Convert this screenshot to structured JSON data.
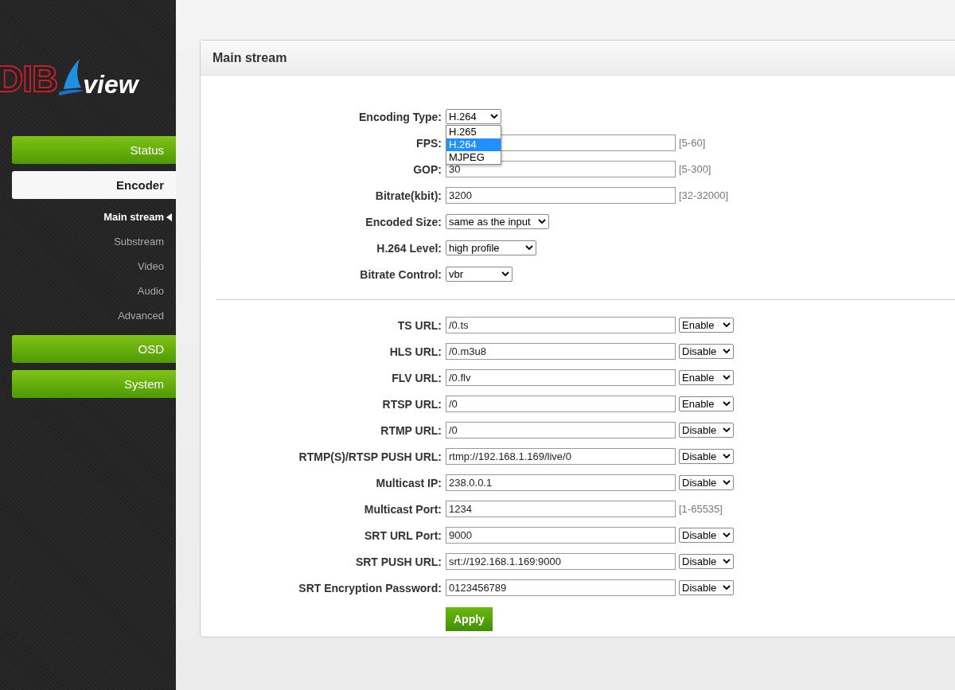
{
  "sidebar": {
    "logo": {
      "brand": "DIB",
      "suffix": "view"
    },
    "menu": [
      {
        "label": "Status",
        "kind": "group",
        "selected": false
      },
      {
        "label": "Encoder",
        "kind": "group",
        "selected": true
      },
      {
        "label": "Main stream",
        "kind": "sub",
        "selected": true
      },
      {
        "label": "Substream",
        "kind": "sub",
        "selected": false
      },
      {
        "label": "Video",
        "kind": "sub",
        "selected": false
      },
      {
        "label": "Audio",
        "kind": "sub",
        "selected": false
      },
      {
        "label": "Advanced",
        "kind": "sub",
        "selected": false
      },
      {
        "label": "OSD",
        "kind": "group",
        "selected": false
      },
      {
        "label": "System",
        "kind": "group",
        "selected": false
      }
    ]
  },
  "panel": {
    "title": "Main stream",
    "encoding_rows": [
      {
        "label": "Encoding Type:",
        "kind": "select",
        "value": "H.264",
        "open_options": [
          {
            "label": "H.265",
            "selected": false
          },
          {
            "label": "H.264",
            "selected": true
          },
          {
            "label": "MJPEG",
            "selected": false
          }
        ]
      },
      {
        "label": "FPS:",
        "kind": "input",
        "value": "",
        "hint": "[5-60]"
      },
      {
        "label": "GOP:",
        "kind": "input",
        "value": "30",
        "hint": "[5-300]"
      },
      {
        "label": "Bitrate(kbit):",
        "kind": "input",
        "value": "3200",
        "hint": "[32-32000]"
      },
      {
        "label": "Encoded Size:",
        "kind": "select",
        "value": "same as the input"
      },
      {
        "label": "H.264 Level:",
        "kind": "select",
        "value": "high profile"
      },
      {
        "label": "Bitrate Control:",
        "kind": "select",
        "value": "vbr"
      }
    ],
    "url_rows": [
      {
        "label": "TS URL:",
        "value": "/0.ts",
        "toggle": "Enable"
      },
      {
        "label": "HLS URL:",
        "value": "/0.m3u8",
        "toggle": "Disable"
      },
      {
        "label": "FLV URL:",
        "value": "/0.flv",
        "toggle": "Enable"
      },
      {
        "label": "RTSP URL:",
        "value": "/0",
        "toggle": "Enable"
      },
      {
        "label": "RTMP URL:",
        "value": "/0",
        "toggle": "Disable"
      },
      {
        "label": "RTMP(S)/RTSP PUSH URL:",
        "value": "rtmp://192.168.1.169/live/0",
        "toggle": "Disable"
      },
      {
        "label": "Multicast IP:",
        "value": "238.0.0.1",
        "toggle": "Disable"
      },
      {
        "label": "Multicast Port:",
        "value": "1234",
        "hint": "[1-65535]"
      },
      {
        "label": "SRT URL Port:",
        "value": "9000",
        "toggle": "Disable"
      },
      {
        "label": "SRT PUSH URL:",
        "value": "srt://192.168.1.169:9000",
        "toggle": "Disable"
      },
      {
        "label": "SRT Encryption Password:",
        "value": "0123456789",
        "toggle": "Disable"
      }
    ],
    "apply_button": "Apply"
  }
}
